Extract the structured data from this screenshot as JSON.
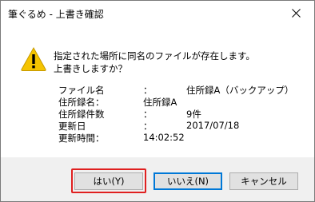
{
  "window": {
    "title": "筆ぐるめ - 上書き確認"
  },
  "message": {
    "line1": "指定された場所に同名のファイルが存在します。",
    "line2": "上書きしますか？"
  },
  "info": [
    {
      "label": "ファイル名",
      "sep": "：",
      "value": "住所録A（バックアップ）"
    },
    {
      "label": "住所録名：",
      "sep": "",
      "value": "住所録A"
    },
    {
      "label": "住所録件数",
      "sep": "：",
      "value": "9件"
    },
    {
      "label": "更新日",
      "sep": "：",
      "value": "2017/07/18"
    },
    {
      "label": "更新時間：",
      "sep": "",
      "value": "14:02:52"
    }
  ],
  "buttons": {
    "yes": "はい(Y)",
    "no": "いいえ(N)",
    "cancel": "キャンセル"
  },
  "colors": {
    "accent": "#0078d7",
    "highlight": "#e02020",
    "warning": "#f5c400"
  }
}
